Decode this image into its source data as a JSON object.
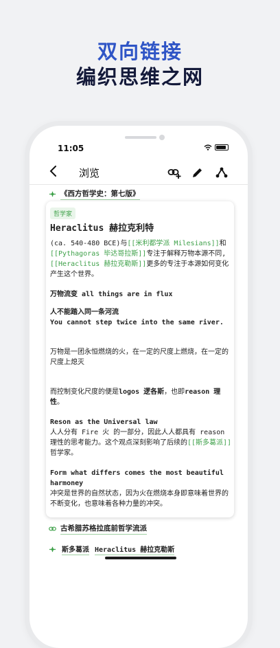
{
  "promo": {
    "line1": "双向链接",
    "line2": "编织思维之网"
  },
  "status_bar": {
    "time": "11:05"
  },
  "navbar": {
    "title": "浏览",
    "icons": [
      "back-icon",
      "add-link-icon",
      "edit-icon",
      "graph-icon"
    ]
  },
  "source_link": "《西方哲学史：第七版》",
  "card": {
    "tag": "哲学家",
    "title": "Heraclitus 赫拉克利特",
    "intro_a": "(ca. 540-480 BCE)与",
    "intro_link1": "[[米利都学派 Milesians]]",
    "intro_b": "和",
    "intro_link2": "[[Pythagoras 毕达哥拉斯]]",
    "intro_c": "专注于解释万物本源不同,",
    "intro_link3": "[[Heraclitus 赫拉克勒斯]]",
    "intro_d": "更多的专注于本源如何变化产生这个世界。",
    "p2": "万物流变 all things are in flux",
    "p3a": "人不能踏入同一条河流",
    "p3b": "You cannot step twice into the same river.",
    "p4": "万物是一团永恒燃烧的火，在一定的尺度上燃烧，在一定的尺度上熄灭",
    "p5a": "而控制变化尺度的便是",
    "p5b": "logos 逻各斯",
    "p5c": "，也即",
    "p5d": "reason 理性",
    "p5e": "。",
    "p6a": "Reson as the Universal law",
    "p6b": "人人分有 Fire 火 的一部分，因此人人都具有 reason 理性的思考能力。这个观点深刻影响了后续的",
    "p6link": "[[斯多葛派]]",
    "p6c": "哲学家。",
    "p7a": "Form what differs comes the most beautiful harmoney",
    "p7b": "冲突是世界的自然状态，因为火在燃烧本身即意味着世界的不断变化，也意味着各种力量的冲突。"
  },
  "backlink": "古希腊苏格拉底前哲学流派",
  "bottom_links": [
    "斯多葛派",
    "Heraclitus 赫拉克勒斯"
  ]
}
